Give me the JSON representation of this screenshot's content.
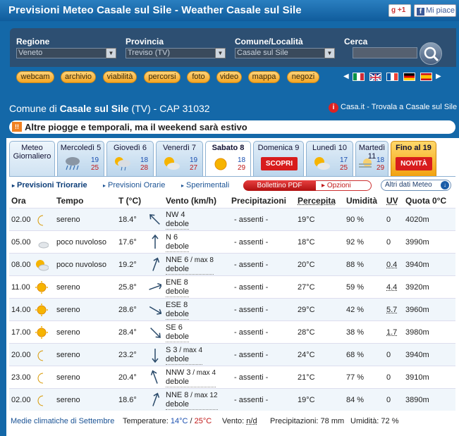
{
  "header": {
    "title": "Previsioni Meteo Casale sul Sile - Weather Casale sul Sile",
    "gplus_label": "+1",
    "gplus_icon": "g",
    "fb_label": "Mi piace",
    "fb_icon": "f"
  },
  "search": {
    "regione": {
      "label": "Regione",
      "value": "Veneto"
    },
    "provincia": {
      "label": "Provincia",
      "value": "Treviso (TV)"
    },
    "comune": {
      "label": "Comune/Località",
      "value": "Casale sul Sile"
    },
    "cerca": {
      "label": "Cerca",
      "value": ""
    }
  },
  "links": [
    "webcam",
    "archivio",
    "viabilità",
    "percorsi",
    "foto",
    "video",
    "mappa",
    "negozi"
  ],
  "location": {
    "prefix": "Comune di",
    "name": "Casale sul Sile",
    "prov": "(TV)",
    "cap": "- CAP 31032",
    "casait": "Casa.it - Trovala a Casale sul Sile",
    "casait_icon": "i"
  },
  "alert": {
    "text": "Altre piogge e temporali, ma il weekend sarà estivo",
    "icon": "!!"
  },
  "days": [
    {
      "name": "Meteo",
      "name2": "Giornaliero"
    },
    {
      "name": "Mercoledì 5",
      "min": "19",
      "max": "25",
      "icon": "rain-cloud-icon"
    },
    {
      "name": "Giovedì 6",
      "min": "18",
      "max": "28",
      "icon": "sun-rain-icon"
    },
    {
      "name": "Venerdì 7",
      "min": "19",
      "max": "27",
      "icon": "partly-cloudy-icon"
    },
    {
      "name": "Sabato 8",
      "min": "18",
      "max": "29",
      "icon": "sun-icon"
    },
    {
      "name": "Domenica 9",
      "badge": "SCOPRI"
    },
    {
      "name": "Lunedì 10",
      "min": "17",
      "max": "25",
      "icon": "partly-cloudy-icon"
    },
    {
      "name": "Martedì 11",
      "min": "18",
      "max": "29",
      "icon": "fog-icon"
    },
    {
      "name": "Fino al 19",
      "badge": "NOVITÀ"
    }
  ],
  "tabs": {
    "triorarie": "Previsioni Triorarie",
    "orarie": "Previsioni Orarie",
    "sperimentali": "Sperimentali",
    "bollettino": "Bollettino PDF",
    "opzioni": "Opzioni",
    "altri": "Altri dati Meteo",
    "arrow": "▸",
    "altri_icon": "↓"
  },
  "columns": [
    "Ora",
    "Tempo",
    "T (°C)",
    "Vento (km/h)",
    "Precipitazioni",
    "Percepita",
    "Umidità",
    "UV",
    "Quota 0°C"
  ],
  "rows": [
    {
      "ora": "02.00",
      "icon": "moon-icon",
      "tempo": "sereno",
      "t": "18.4°",
      "dir": "NW 4",
      "max": "",
      "lev": "debole",
      "prec": "- assenti -",
      "perc": "19°C",
      "umid": "90 %",
      "uv": "0",
      "quota": "4020m",
      "arrow": 135
    },
    {
      "ora": "05.00",
      "icon": "moon-cloud-icon",
      "tempo": "poco nuvoloso",
      "t": "17.6°",
      "dir": "N 6",
      "max": "",
      "lev": "debole",
      "prec": "- assenti -",
      "perc": "18°C",
      "umid": "92 %",
      "uv": "0",
      "quota": "3990m",
      "arrow": 180
    },
    {
      "ora": "08.00",
      "icon": "sun-cloud-icon",
      "tempo": "poco nuvoloso",
      "t": "19.2°",
      "dir": "NNE 6",
      "max": " / max 8",
      "lev": "debole",
      "prec": "- assenti -",
      "perc": "20°C",
      "umid": "88 %",
      "uv": "0.4",
      "quota": "3940m",
      "arrow": 200
    },
    {
      "ora": "11.00",
      "icon": "sun-icon",
      "tempo": "sereno",
      "t": "25.8°",
      "dir": "ENE 8",
      "max": "",
      "lev": "debole",
      "prec": "- assenti -",
      "perc": "27°C",
      "umid": "59 %",
      "uv": "4.4",
      "quota": "3920m",
      "arrow": 250
    },
    {
      "ora": "14.00",
      "icon": "sun-icon",
      "tempo": "sereno",
      "t": "28.6°",
      "dir": "ESE 8",
      "max": "",
      "lev": "debole",
      "prec": "- assenti -",
      "perc": "29°C",
      "umid": "42 %",
      "uv": "5.7",
      "quota": "3960m",
      "arrow": 300
    },
    {
      "ora": "17.00",
      "icon": "sun-icon",
      "tempo": "sereno",
      "t": "28.4°",
      "dir": "SE 6",
      "max": "",
      "lev": "debole",
      "prec": "- assenti -",
      "perc": "28°C",
      "umid": "38 %",
      "uv": "1.7",
      "quota": "3980m",
      "arrow": 315
    },
    {
      "ora": "20.00",
      "icon": "moon-icon",
      "tempo": "sereno",
      "t": "23.2°",
      "dir": "S 3",
      "max": " / max 4",
      "lev": "debole",
      "prec": "- assenti -",
      "perc": "24°C",
      "umid": "68 %",
      "uv": "0",
      "quota": "3940m",
      "arrow": 0
    },
    {
      "ora": "23.00",
      "icon": "moon-icon",
      "tempo": "sereno",
      "t": "20.4°",
      "dir": "NNW 3",
      "max": " / max 4",
      "lev": "debole",
      "prec": "- assenti -",
      "perc": "21°C",
      "umid": "77 %",
      "uv": "0",
      "quota": "3910m",
      "arrow": 160
    },
    {
      "ora": "02.00",
      "icon": "moon-icon",
      "tempo": "sereno",
      "t": "18.6°",
      "dir": "NNE 8",
      "max": " / max 12",
      "lev": "debole",
      "prec": "- assenti -",
      "perc": "19°C",
      "umid": "84 %",
      "uv": "0",
      "quota": "3890m",
      "arrow": 200
    }
  ],
  "footer": {
    "medie": "Medie climatiche di Settembre",
    "temp_label": "Temperature:",
    "temp_min": "14°C",
    "sep": "/",
    "temp_max": "25°C",
    "vento_label": "Vento:",
    "vento": "n/d",
    "prec": "Precipitazioni: 78 mm",
    "umid": "Umidità: 72 %"
  },
  "colors": {
    "brand": "#1468a8",
    "min": "#1a4fb0",
    "max": "#c01818",
    "badge": "#d81c1c"
  }
}
